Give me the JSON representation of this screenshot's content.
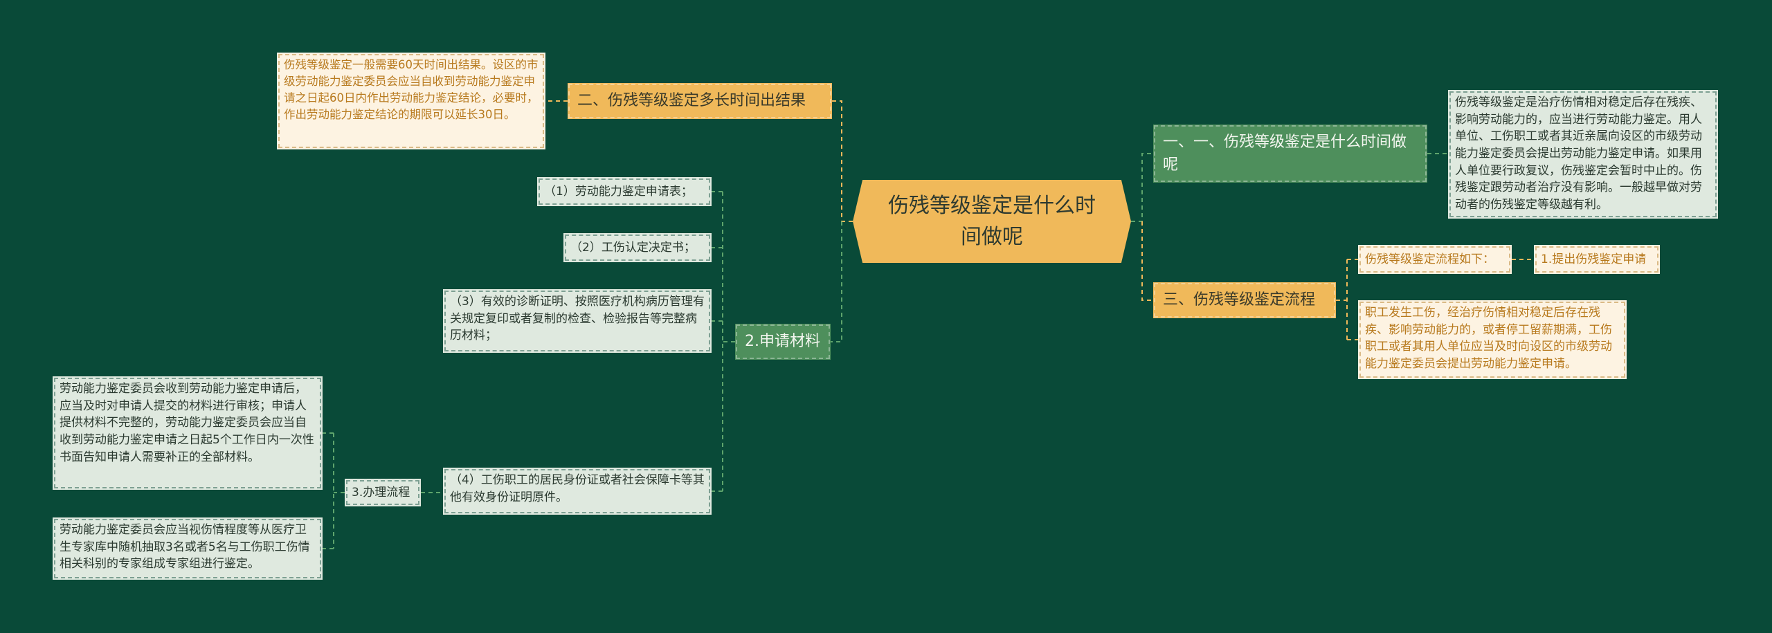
{
  "root": {
    "title": "伤残等级鉴定是什么时间做呢"
  },
  "branches": {
    "time_result": {
      "label": "二、伤残等级鉴定多长时间出结果",
      "detail": "伤残等级鉴定一般需要60天时间出结果。设区的市级劳动能力鉴定委员会应当自收到劳动能力鉴定申请之日起60日内作出劳动能力鉴定结论，必要时，作出劳动能力鉴定结论的期限可以延长30日。"
    },
    "materials": {
      "label": "2.申请材料",
      "items": [
        "（1）劳动能力鉴定申请表；",
        "（2）工伤认定决定书；",
        "（3）有效的诊断证明、按照医疗机构病历管理有关规定复印或者复制的检查、检验报告等完整病历材料；",
        "（4）工伤职工的居民身份证或者社会保障卡等其他有效身份证明原件。"
      ]
    },
    "process": {
      "label": "3.办理流程",
      "items": [
        "劳动能力鉴定委员会收到劳动能力鉴定申请后，应当及时对申请人提交的材料进行审核；申请人提供材料不完整的，劳动能力鉴定委员会应当自收到劳动能力鉴定申请之日起5个工作日内一次性书面告知申请人需要补正的全部材料。",
        "劳动能力鉴定委员会应当视伤情程度等从医疗卫生专家库中随机抽取3名或者5名与工伤职工伤情相关科别的专家组成专家组进行鉴定。"
      ]
    },
    "when": {
      "label": "一、一、伤残等级鉴定是什么时间做呢",
      "detail": "伤残等级鉴定是治疗伤情相对稳定后存在残疾、影响劳动能力的，应当进行劳动能力鉴定。用人单位、工伤职工或者其近亲属向设区的市级劳动能力鉴定委员会提出劳动能力鉴定申请。如果用人单位要行政复议，伤残鉴定会暂时中止的。伤残鉴定跟劳动者治疗没有影响。一般越早做对劳动者的伤残鉴定等级越有利。"
    },
    "flow": {
      "label": "三、伤残等级鉴定流程",
      "intro": "伤残等级鉴定流程如下：",
      "step1": "1.提出伤残鉴定申请",
      "detail": "职工发生工伤，经治疗伤情相对稳定后存在残疾、影响劳动能力的，或者停工留薪期满，工伤职工或者其用人单位应当及时向设区的市级劳动能力鉴定委员会提出劳动能力鉴定申请。"
    }
  },
  "colors": {
    "background": "#094a38",
    "orange": "#f0b95a",
    "green": "#4e8f5c",
    "leaf_green": "#dfe9df",
    "leaf_orange": "#fdf3e2"
  }
}
